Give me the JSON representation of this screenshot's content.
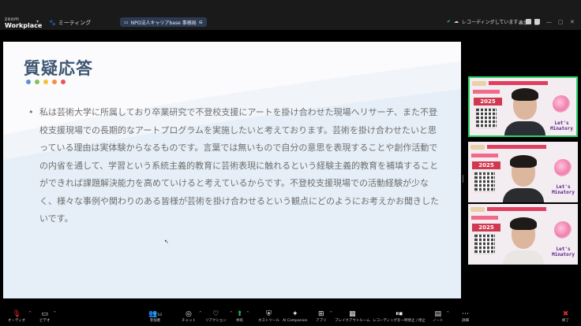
{
  "app": {
    "brand_top": "zoom",
    "brand_bottom": "Workplace"
  },
  "header": {
    "meeting_label": "ミーティング",
    "share_pill": "NPO法人キャリアbase 事務局",
    "recording_text": "レコーディングしています...",
    "view_label": "表示"
  },
  "slide": {
    "title": "質疑応答",
    "dot_colors": [
      "#5b8fd6",
      "#7dc45a",
      "#f2c230",
      "#f0923a",
      "#e8555a"
    ],
    "body": "私は芸術大学に所属しており卒業研究で不登校支援にアートを掛け合わせた現場へリサーチ、また不登校支援現場での長期的なアートプログラムを実施したいと考えております。芸術を掛け合わせたいと思っている理由は実体験からなるものです。言葉では無いもので自分の意思を表現することや創作活動での内省を通して、学習という系統主義的教育に芸術表現に触れるという経験主義的教育を補填することができれば課題解決能力を高めていけると考えているからです。不登校支援現場での活動経験が少なく、様々な事例や関わりのある皆様が芸術を掛け合わせるという観点にどのようにお考えかお聞きしたいです。"
  },
  "participants": [
    {
      "year": "2025",
      "lets": "Let's\nMinatory",
      "active": true,
      "shirt": "#2b2f35"
    },
    {
      "year": "2025",
      "lets": "Let's\nMinatory",
      "active": false,
      "shirt": "#2a2c30"
    },
    {
      "year": "2025",
      "lets": "Let's\nMinatory",
      "active": false,
      "shirt": "#e9e6e3"
    }
  ],
  "toolbar": {
    "audio": "オーディオ",
    "video": "ビデオ",
    "participants": "参加者",
    "participants_count": "10",
    "chat": "チャット",
    "reactions": "リアクション",
    "share": "共有",
    "host_tools": "ホストツール",
    "ai_companion": "AI Companion",
    "apps": "アプリ",
    "breakout": "ブレイクアウトルーム",
    "recording": "レコーディングを一時停止 / 停止",
    "notes": "ノート",
    "more": "詳細",
    "end": "終了"
  },
  "colors": {
    "accent_green": "#2fd16a",
    "share_green": "#1fba5c",
    "end_red": "#e02a2a",
    "title_blue": "#3d5773"
  }
}
